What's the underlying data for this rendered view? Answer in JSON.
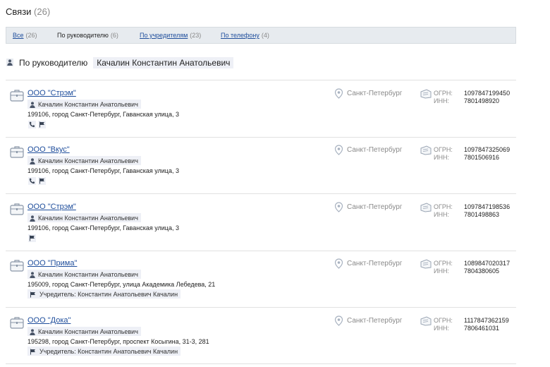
{
  "header": {
    "title": "Связи",
    "count": "(26)"
  },
  "tabs": [
    {
      "label": "Все",
      "count": "(26)",
      "active": false
    },
    {
      "label": "По руководителю",
      "count": "(6)",
      "active": true
    },
    {
      "label": "По учредителям",
      "count": "(23)",
      "active": false
    },
    {
      "label": "По телефону",
      "count": "(4)",
      "active": false
    }
  ],
  "filter": {
    "label": "По руководителю",
    "value": "Качалин Константин Анатольевич"
  },
  "labels": {
    "ogrn": "ОГРН:",
    "inn": "ИНН:"
  },
  "entries": [
    {
      "name": "ООО \"Стрэм\"",
      "person": "Качалин Константин Анатольевич",
      "address": "199106, город Санкт-Петербург, Гаванская улица, 3",
      "city": "Санкт-Петербург",
      "ogrn": "1097847199450",
      "inn": "7801498920",
      "markers": [
        "phone-icon",
        "flag-icon"
      ],
      "founder": ""
    },
    {
      "name": "ООО \"Вкус\"",
      "person": "Качалин Константин Анатольевич",
      "address": "199106, город Санкт-Петербург, Гаванская улица, 3",
      "city": "Санкт-Петербург",
      "ogrn": "1097847325069",
      "inn": "7801506916",
      "markers": [
        "phone-icon",
        "flag-icon"
      ],
      "founder": ""
    },
    {
      "name": "ООО \"Стрэм\"",
      "person": "Качалин Константин Анатольевич",
      "address": "199106, город Санкт-Петербург, Гаванская улица, 3",
      "city": "Санкт-Петербург",
      "ogrn": "1097847198536",
      "inn": "7801498863",
      "markers": [
        "flag-icon"
      ],
      "founder": ""
    },
    {
      "name": "ООО \"Прима\"",
      "person": "Качалин Константин Анатольевич",
      "address": "195009, город Санкт-Петербург, улица Академика Лебедева, 21",
      "city": "Санкт-Петербург",
      "ogrn": "1089847020317",
      "inn": "7804380605",
      "markers": [],
      "founder": "Учредитель: Константин Анатольевич Качалин"
    },
    {
      "name": "ООО \"Дока\"",
      "person": "Качалин Константин Анатольевич",
      "address": "195298, город Санкт-Петербург, проспект Косыгина, 31-3, 281",
      "city": "Санкт-Петербург",
      "ogrn": "1117847362159",
      "inn": "7806461031",
      "markers": [],
      "founder": "Учредитель: Константин Анатольевич Качалин"
    }
  ]
}
